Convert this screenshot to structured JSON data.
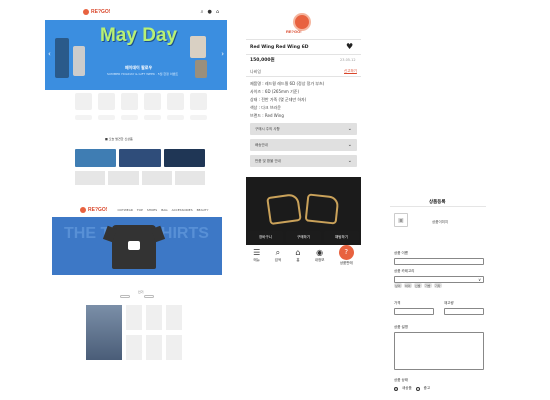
{
  "home_mobile": {
    "logo_text": "RE?GO!",
    "header_icons": [
      "search-icon",
      "user-icon",
      "home-icon"
    ],
    "banner": {
      "headline": "May Day",
      "subtitle": "메이데이 팔로우",
      "caption": "SUMMER HOLIDAY & GIFT WEEK · 5월 한정 이벤트"
    },
    "section_title": "■ 오늘 발견한 신상품"
  },
  "home_desktop": {
    "logo_text": "RE?GO!",
    "nav": [
      "OUTWEAR",
      "TOP",
      "SHOES",
      "BAG",
      "ACCESSORIES",
      "BEAUTY"
    ],
    "banner_text": "THE TEE T-SHIRTS",
    "section_label": "인기"
  },
  "product": {
    "logo_text": "RE?GO!",
    "title": "Red Wing Red Wing 6D",
    "price": "150,000원",
    "date": "23.05.12",
    "seller": "나비잉",
    "report": "신고하기",
    "info_lines": [
      "제품명 : 레드윙 레드윙 6D (정상 정가 부츠)",
      "사이즈 : 6D (265mm 기준)",
      "상태 : 전반 가죽 (몇 군데만 하자)",
      "색상 : 다크 브라운",
      "브랜드 : Red Wing"
    ],
    "accordions": [
      "구매시 주의 사항",
      "배송안내",
      "반품 및 환불 안내"
    ],
    "actions": [
      "장바구니",
      "구매하기",
      "채팅하기"
    ],
    "tabbar": [
      {
        "icon": "menu-icon",
        "label": "메뉴"
      },
      {
        "icon": "search-icon",
        "label": "검색"
      },
      {
        "icon": "home-icon",
        "label": "홈"
      },
      {
        "icon": "user-icon",
        "label": "내정보"
      },
      {
        "icon": "sell-icon",
        "label": "상품판매"
      }
    ]
  },
  "register_form": {
    "title": "상품등록",
    "image_label": "상품이미지",
    "fields": {
      "name_label": "상품 이름",
      "category_label": "상품 카테고리",
      "category_value": "∨",
      "price_label": "가격",
      "stock_label": "재고량",
      "desc_label": "상품 설명",
      "status_label": "상품 상태"
    },
    "chips": [
      "상의",
      "하의",
      "신발",
      "가방",
      "기타"
    ],
    "status_options": [
      "새상품",
      "중고"
    ]
  }
}
